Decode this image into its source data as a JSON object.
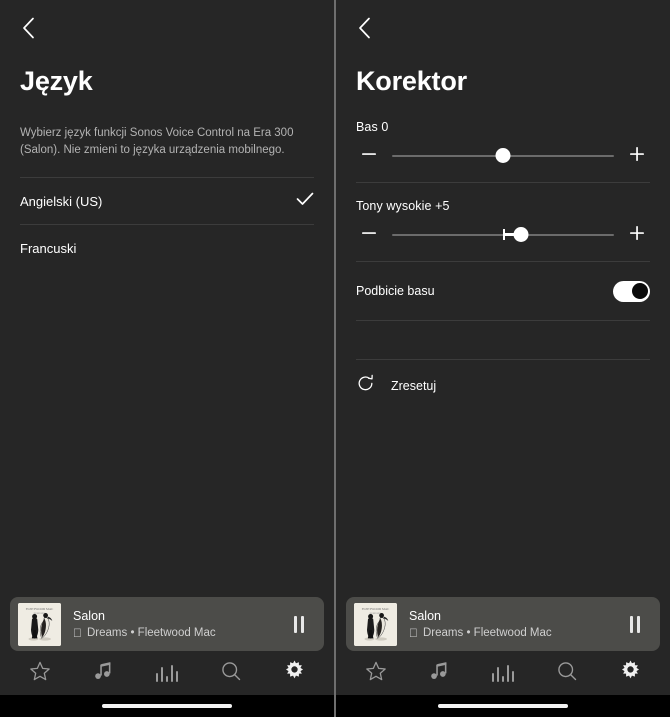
{
  "language_screen": {
    "back_icon": "chevron-left-icon",
    "title": "Język",
    "description": "Wybierz język funkcji Sonos Voice Control na Era 300 (Salon). Nie zmieni to języka urządzenia mobilnego.",
    "options": [
      {
        "label": "Angielski (US)",
        "selected": true,
        "check_icon": "check-icon"
      },
      {
        "label": "Francuski",
        "selected": false,
        "check_icon": ""
      }
    ]
  },
  "eq_screen": {
    "back_icon": "chevron-left-icon",
    "title": "Korektor",
    "sliders": [
      {
        "label": "Bas 0",
        "value": 0,
        "percent": 50,
        "show_tick": false,
        "fill_from": 50,
        "minus_icon": "minus-icon",
        "plus_icon": "plus-icon"
      },
      {
        "label": "Tony wysokie +5",
        "value": 5,
        "percent": 58,
        "show_tick": true,
        "fill_from": 50,
        "minus_icon": "minus-icon",
        "plus_icon": "plus-icon"
      }
    ],
    "toggle": {
      "label": "Podbicie basu",
      "state": "on"
    },
    "reset": {
      "label": "Zresetuj",
      "icon": "reset-rotate-icon"
    }
  },
  "now_playing": {
    "album_art_alt": "rumours-album-art",
    "room": "Salon",
    "service_icon": "apple-music-icon",
    "subtitle": "Dreams • Fleetwood Mac",
    "pause_icon": "pause-icon"
  },
  "tabbar": {
    "items": [
      {
        "icon": "star-icon",
        "active": false
      },
      {
        "icon": "music-note-icon",
        "active": false
      },
      {
        "icon": "equalizer-bars-icon",
        "active": false
      },
      {
        "icon": "search-icon",
        "active": false
      },
      {
        "icon": "gear-icon",
        "active": true
      }
    ]
  },
  "colors": {
    "background": "#262626",
    "divider": "#3c3c3c",
    "now_playing_bg": "#4c4c49",
    "text_primary": "#ffffff",
    "text_secondary": "#b3b3b3",
    "accent": "#ffffff",
    "home_bar": "#f2f2f2"
  }
}
